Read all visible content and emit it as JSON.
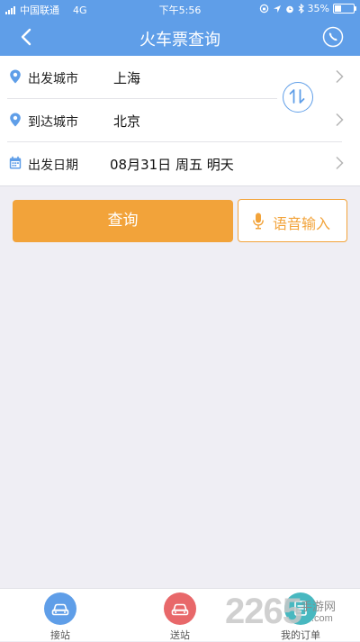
{
  "status_bar": {
    "carrier": "中国联通",
    "network": "4G",
    "time": "下午5:56",
    "battery": "35%",
    "battery_level": 0.35
  },
  "nav": {
    "title": "火车票查询",
    "back_icon": "chevron-left-icon",
    "right_icon": "phone-icon"
  },
  "form": {
    "rows": [
      {
        "label": "出发城市",
        "value": "上海",
        "icon": "location-pin-icon"
      },
      {
        "label": "到达城市",
        "value": "北京",
        "icon": "location-pin-icon"
      },
      {
        "label": "出发日期",
        "value": "08月31日 周五 明天",
        "icon": "calendar-icon"
      }
    ],
    "swap_icon": "swap-arrows-icon"
  },
  "actions": {
    "search_label": "查询",
    "voice_label": "语音输入",
    "voice_icon": "microphone-icon"
  },
  "tabs": [
    {
      "label": "接站",
      "icon": "car-icon",
      "color": "#5f9ee8"
    },
    {
      "label": "送站",
      "icon": "car-icon",
      "color": "#e8686a"
    },
    {
      "label": "我的订单",
      "icon": "order-icon",
      "color": "#48b8c0"
    }
  ],
  "watermark": {
    "number": "2265",
    "site": "手游网",
    "domain": ".com"
  },
  "colors": {
    "primary": "#5f9ee8",
    "accent": "#f2a33a",
    "background": "#efeef4"
  }
}
